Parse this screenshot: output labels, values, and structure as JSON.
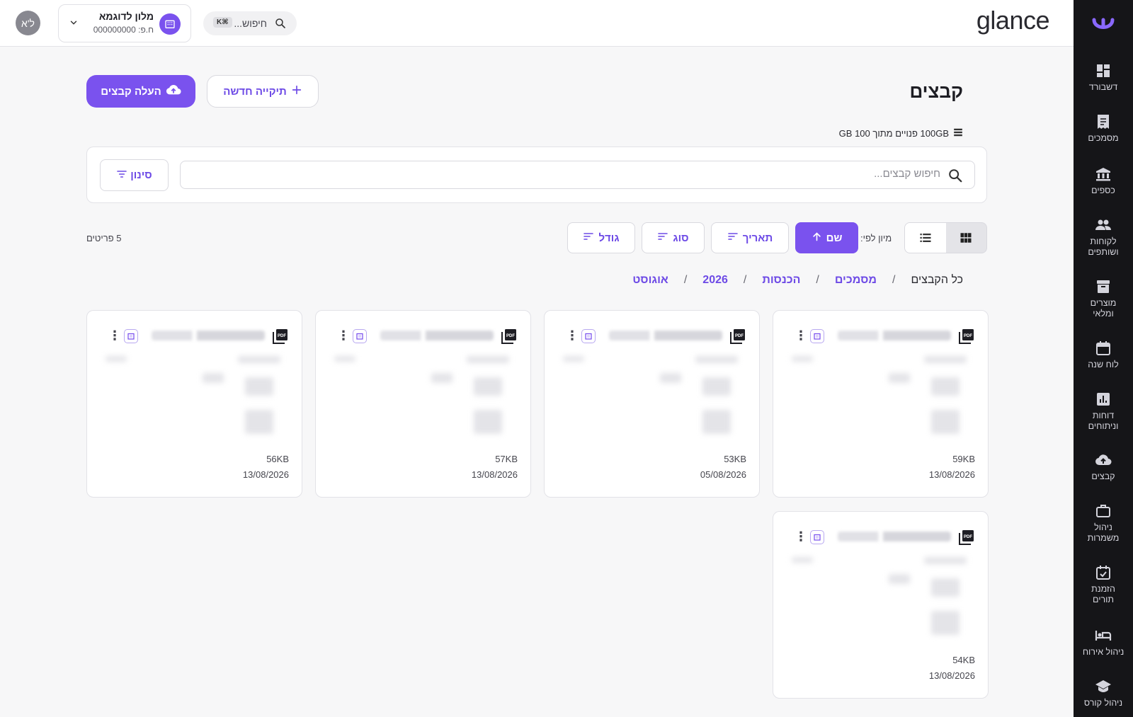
{
  "brand": "glance",
  "topbar": {
    "avatar_initials": "ל'א",
    "business_name": "מלון לדוגמא",
    "business_id": "ח.פ: 000000000",
    "global_search_placeholder": "חיפוש...",
    "search_shortcut": "K⌘"
  },
  "sidebar": {
    "items": [
      {
        "label": "דשבורד",
        "icon": "dashboard-icon"
      },
      {
        "label": "מסמכים",
        "icon": "receipt-icon"
      },
      {
        "label": "כספים",
        "icon": "bank-icon"
      },
      {
        "label": "לקוחות ושותפים",
        "icon": "people-icon"
      },
      {
        "label": "מוצרים ומלאי",
        "icon": "archive-icon"
      },
      {
        "label": "לוח שנה",
        "icon": "calendar-icon"
      },
      {
        "label": "דוחות וניתוחים",
        "icon": "bar-chart-icon"
      },
      {
        "label": "קבצים",
        "icon": "cloud-upload-icon"
      },
      {
        "label": "ניהול משמרות",
        "icon": "briefcase-icon"
      },
      {
        "label": "הזמנת תורים",
        "icon": "calendar-check-icon"
      },
      {
        "label": "ניהול אירוח",
        "icon": "bed-icon"
      },
      {
        "label": "ניהול קורס",
        "icon": "graduation-cap-icon"
      }
    ]
  },
  "page": {
    "title": "קבצים",
    "upload_button": "העלה קבצים",
    "new_folder_button": "תיקייה חדשה",
    "storage_text": "100GB פנויים מתוך 100 GB"
  },
  "filters": {
    "search_placeholder": "חיפוש קבצים...",
    "search_value": "",
    "filter_button": "סינון"
  },
  "sort": {
    "label": "מיון לפי:",
    "buttons": [
      "שם",
      "תאריך",
      "סוג",
      "גודל"
    ],
    "active": "שם",
    "item_count": "5 פריטים"
  },
  "breadcrumb": [
    "כל הקבצים",
    "מסמכים",
    "הכנסות",
    "2026",
    "אוגוסט"
  ],
  "files": [
    {
      "size": "59KB",
      "date": "13/08/2026"
    },
    {
      "size": "53KB",
      "date": "05/08/2026"
    },
    {
      "size": "57KB",
      "date": "13/08/2026"
    },
    {
      "size": "56KB",
      "date": "13/08/2026"
    },
    {
      "size": "54KB",
      "date": "13/08/2026"
    }
  ],
  "colors": {
    "accent": "#7a52ee",
    "sidebar_bg": "#151518",
    "page_bg": "#f7f7f8"
  }
}
